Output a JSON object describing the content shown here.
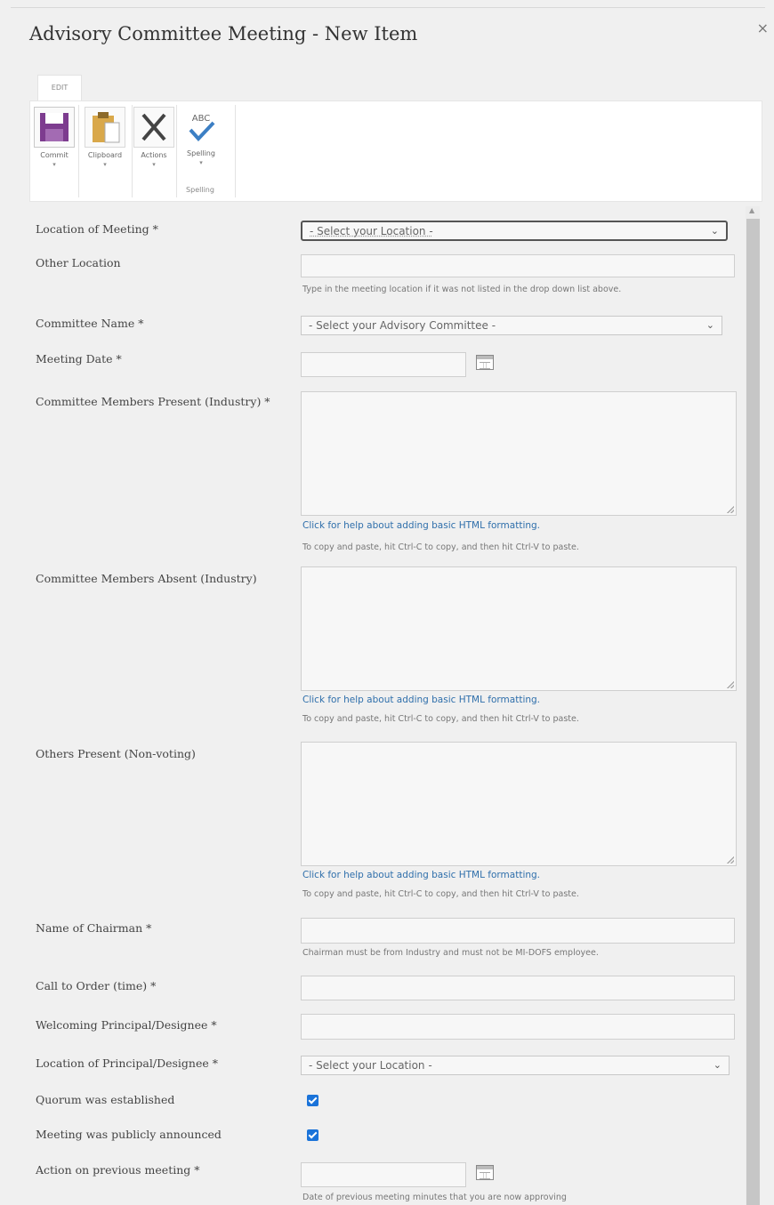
{
  "dialog": {
    "title": "Advisory Committee Meeting - New Item",
    "close_glyph": "×"
  },
  "ribbon": {
    "tab_label": "EDIT",
    "buttons": [
      {
        "label": "Commit",
        "icon": "save-icon",
        "caret": "▾"
      },
      {
        "label": "Clipboard",
        "icon": "clipboard-icon",
        "caret": "▾"
      },
      {
        "label": "Actions",
        "icon": "cancel-icon",
        "caret": "▾"
      },
      {
        "label": "Spelling",
        "icon": "spelling-check-icon",
        "caret": "▾"
      }
    ],
    "group_label": "Spelling",
    "spelling_icon_text": "ABC"
  },
  "form": {
    "location_of_meeting": {
      "label": "Location of Meeting *",
      "value": "- Select your Location -"
    },
    "other_location": {
      "label": "Other Location",
      "hint": "Type in the meeting location if it was not listed in the drop down list above."
    },
    "committee_name": {
      "label": "Committee Name *",
      "value": "- Select your Advisory Committee -"
    },
    "meeting_date": {
      "label": "Meeting Date *"
    },
    "members_present": {
      "label": "Committee Members Present (Industry) *",
      "help": "Click for help about adding basic HTML formatting.",
      "hint": "To copy and paste, hit Ctrl-C to copy, and then hit Ctrl-V to paste."
    },
    "members_absent": {
      "label": "Committee Members Absent (Industry)",
      "help": "Click for help about adding basic HTML formatting.",
      "hint": "To copy and paste, hit Ctrl-C to copy, and then hit Ctrl-V to paste."
    },
    "others_present": {
      "label": "Others Present (Non-voting)",
      "help": "Click for help about adding basic HTML formatting.",
      "hint": "To copy and paste, hit Ctrl-C to copy, and then hit Ctrl-V to paste."
    },
    "chairman": {
      "label": "Name of Chairman *",
      "hint": "Chairman must be from Industry and must not be MI-DOFS employee."
    },
    "call_to_order": {
      "label": "Call to Order (time) *"
    },
    "welcoming_principal": {
      "label": "Welcoming Principal/Designee *"
    },
    "principal_location": {
      "label": "Location of Principal/Designee *",
      "value": "- Select your Location -"
    },
    "quorum": {
      "label": "Quorum was established",
      "checked": true
    },
    "announced": {
      "label": "Meeting was publicly announced",
      "checked": true
    },
    "previous_meeting": {
      "label": "Action on previous meeting *",
      "hint": "Date of previous meeting minutes that you are now approving"
    }
  }
}
